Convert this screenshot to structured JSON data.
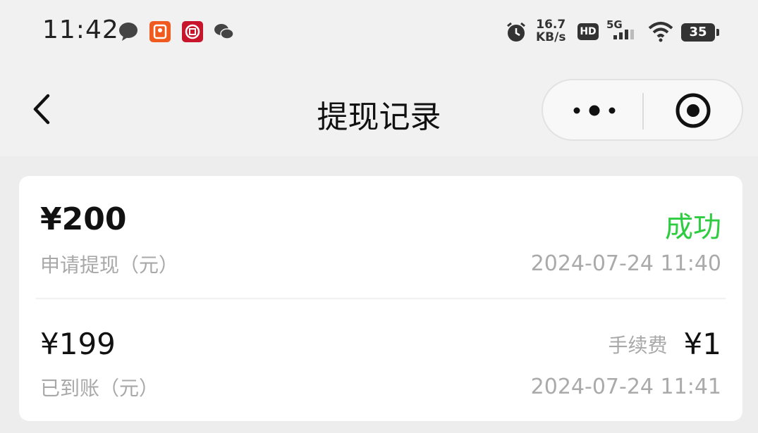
{
  "status_bar": {
    "time": "11:42",
    "net_speed_top": "16.7",
    "net_speed_bottom": "KB/s",
    "hd": "HD",
    "network": "5G",
    "battery": "35",
    "icons": [
      "message-bubble-icon",
      "app-orange-icon",
      "bank-app-icon",
      "wechat-icon",
      "alarm-icon",
      "wifi-icon",
      "battery-icon"
    ]
  },
  "nav": {
    "title": "提现记录",
    "back_icon": "chevron-left-icon",
    "more_icon": "more-dots-icon",
    "close_icon": "target-close-icon"
  },
  "record": {
    "request_amount": "¥200",
    "request_label": "申请提现（元）",
    "status": "成功",
    "status_color": "#2ecc40",
    "request_time": "2024-07-24 11:40",
    "received_amount": "¥199",
    "received_label": "已到账（元）",
    "fee_label": "手续费",
    "fee_value": "¥1",
    "received_time": "2024-07-24 11:41"
  }
}
